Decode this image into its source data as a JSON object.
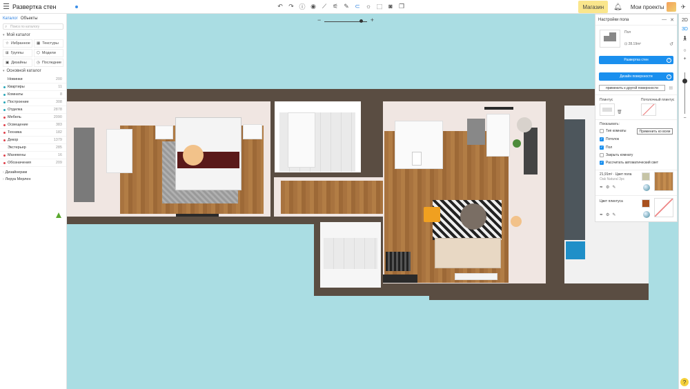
{
  "topbar": {
    "menu_icon": "hamburger-icon",
    "title": "Развертка стен",
    "shop_label": "Магазин",
    "my_projects_label": "Мои проекты",
    "tools": [
      "undo-icon",
      "redo-icon",
      "info-icon",
      "eye-icon",
      "measure-icon",
      "ruler-icon",
      "paint-icon",
      "magnet-icon",
      "sun-icon",
      "export-icon",
      "camera-icon",
      "views-icon"
    ]
  },
  "catalog": {
    "tab_catalog": "Каталог",
    "tab_objects": "Объекты",
    "search_placeholder": "Поиск по каталогу",
    "my_catalog": "Мой каталог",
    "quick": [
      {
        "label": "Избранное",
        "icon": "star-icon"
      },
      {
        "label": "Текстуры",
        "icon": "texture-icon"
      },
      {
        "label": "Группы",
        "icon": "group-icon"
      },
      {
        "label": "Модели",
        "icon": "model-icon"
      },
      {
        "label": "Дизайны",
        "icon": "design-icon"
      },
      {
        "label": "Последние",
        "icon": "clock-icon"
      }
    ],
    "main_catalog": "Основной каталог",
    "categories": [
      {
        "name": "Новинки",
        "count": "200",
        "color": "#ffffff"
      },
      {
        "name": "Квартиры",
        "count": "11",
        "color": "#26a6b8"
      },
      {
        "name": "Комнаты",
        "count": "8",
        "color": "#26a6b8"
      },
      {
        "name": "Построение",
        "count": "308",
        "color": "#26a6b8"
      },
      {
        "name": "Отделка",
        "count": "2878",
        "color": "#26a6b8"
      },
      {
        "name": "Мебель",
        "count": "2090",
        "color": "#e0404a"
      },
      {
        "name": "Освещение",
        "count": "383",
        "color": "#e0404a"
      },
      {
        "name": "Техника",
        "count": "182",
        "color": "#e0404a"
      },
      {
        "name": "Декор",
        "count": "1379",
        "color": "#e0404a"
      },
      {
        "name": "Экстерьер",
        "count": "285",
        "color": "#ffffff"
      },
      {
        "name": "Манекены",
        "count": "16",
        "color": "#e0404a"
      },
      {
        "name": "Обозначения",
        "count": "209",
        "color": "#e0404a"
      }
    ],
    "designers": "Дизайнерам",
    "leroy": "Леруа Мерлен"
  },
  "zoom": {
    "level": 0.85
  },
  "settings": {
    "title": "Настройки пола",
    "floor_name": "Пол",
    "floor_area": "28.19m²",
    "wall_unfold_btn": "Развертка стен",
    "surface_design_btn": "Дизайн поверхности",
    "apply_other_btn": "применить к другой поверхности",
    "plinth_label": "Плинтус",
    "ceiling_plinth_label": "Потолочный плинтус",
    "show_label": "Показывать:",
    "apply_all_btn": "Применить ко всем",
    "checks": [
      {
        "label": "Тип комнаты",
        "checked": false
      },
      {
        "label": "Потолок",
        "checked": true
      },
      {
        "label": "Пол",
        "checked": true
      },
      {
        "label": "Закрыть комнату",
        "checked": false
      },
      {
        "label": "Рассчитать автоматический свет",
        "checked": true
      }
    ],
    "floor_color_label": "21,91m² · Цвет пола",
    "floor_color_sub": "Oak Natural 3pc",
    "plinth_color_label": "Цвет плинтуса",
    "floor_swatch": "#c6c4a6",
    "wood_swatch": "#bf8b44",
    "plinth_swatch": "#a8501e"
  },
  "view_bar": {
    "mode_2d": "2D",
    "mode_3d": "3D",
    "walk_icon": "walk-icon",
    "help": "?"
  }
}
